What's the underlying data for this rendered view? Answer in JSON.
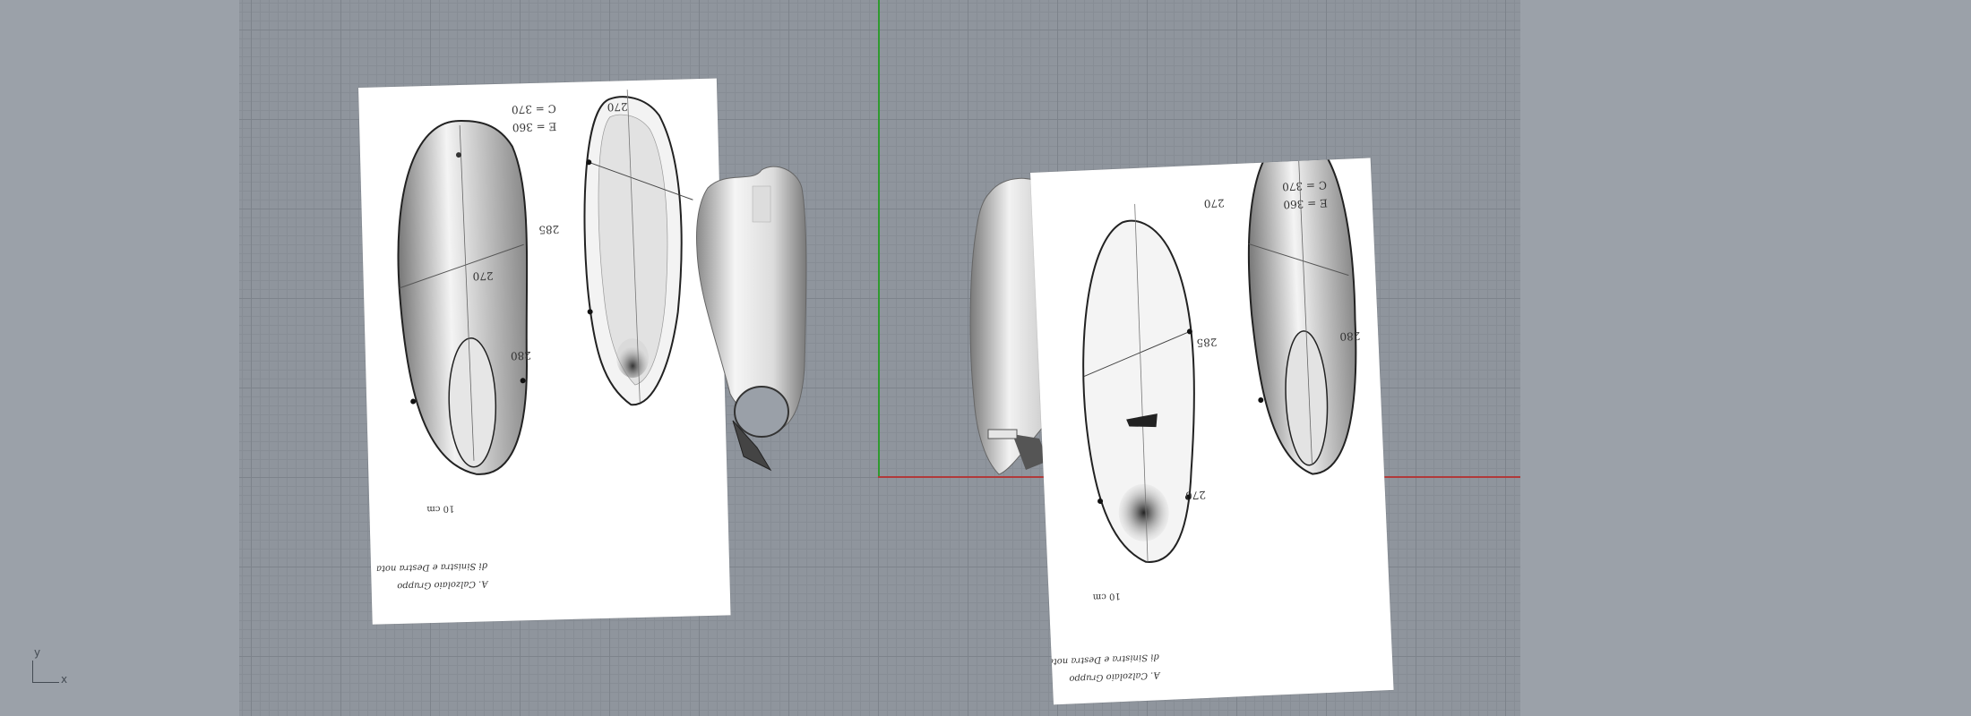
{
  "viewport": {
    "background": "#9ba1a9",
    "grid_color": "#8f959d",
    "x_axis_color": "#b13a3a",
    "y_axis_color": "#2f9a2f"
  },
  "triad": {
    "x_label": "x",
    "y_label": "y"
  },
  "sheets": [
    {
      "name": "left-sheet",
      "labels": {
        "top1": "C = 370",
        "top2": "E = 360",
        "top3": "270",
        "side1": "285",
        "side2": "280",
        "side3": "270",
        "scale": "10 cm",
        "footer1": "A. Calzolaio Gruppo",
        "footer2": "di Sinistra e Destra nota"
      }
    },
    {
      "name": "right-sheet",
      "labels": {
        "top1": "C = 370",
        "top2": "E = 360",
        "top3": "270",
        "side1": "285",
        "side2": "280",
        "side3": "270",
        "scale": "10 cm",
        "footer1": "A. Calzolaio Gruppo",
        "footer2": "di Sinistra e Destra nota"
      }
    }
  ]
}
